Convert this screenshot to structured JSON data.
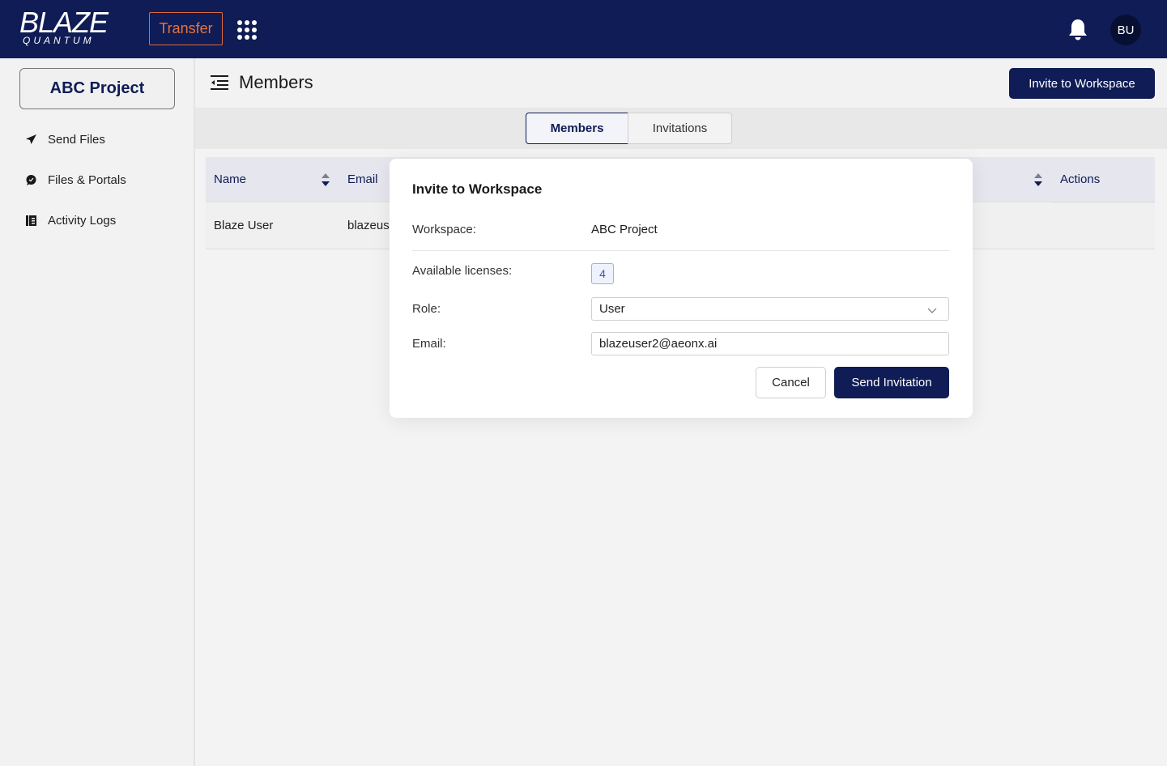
{
  "app": {
    "logo_main": "BLAZE",
    "logo_sub": "QUANTUM",
    "module_button": "Transfer",
    "user_initials": "BU"
  },
  "sidebar": {
    "project": "ABC Project",
    "items": [
      {
        "label": "Send Files",
        "icon": "send-icon"
      },
      {
        "label": "Files & Portals",
        "icon": "chat-icon"
      },
      {
        "label": "Activity Logs",
        "icon": "logs-icon"
      }
    ]
  },
  "header": {
    "title": "Members",
    "invite_button": "Invite to Workspace"
  },
  "tabs": [
    {
      "label": "Members",
      "active": true
    },
    {
      "label": "Invitations",
      "active": false
    }
  ],
  "table": {
    "columns": [
      "Name",
      "Email",
      "Actions"
    ],
    "rows": [
      {
        "name": "Blaze User",
        "email": "blazeus"
      }
    ]
  },
  "modal": {
    "title": "Invite to Workspace",
    "workspace_label": "Workspace:",
    "workspace_value": "ABC Project",
    "licenses_label": "Available licenses:",
    "licenses_value": "4",
    "role_label": "Role:",
    "role_value": "User",
    "email_label": "Email:",
    "email_value": "blazeuser2@aeonx.ai",
    "cancel": "Cancel",
    "send": "Send Invitation"
  },
  "colors": {
    "navy": "#0f1c55",
    "accent_orange": "#e8733f"
  }
}
